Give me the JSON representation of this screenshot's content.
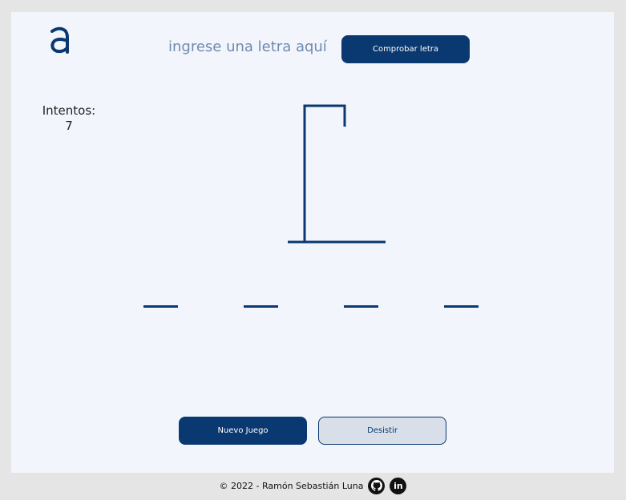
{
  "header": {
    "input_placeholder": "ingrese una letra aquí",
    "check_button_label": "Comprobar letra"
  },
  "game": {
    "tries_label": "Intentos:",
    "tries_value": "7",
    "word_slots": 4
  },
  "actions": {
    "new_game_label": "Nuevo Juego",
    "give_up_label": "Desistir"
  },
  "footer": {
    "copyright": "© 2022 - Ramón Sebastián Luna",
    "linkedin_glyph": "in",
    "icons": [
      "github-icon",
      "linkedin-icon"
    ]
  },
  "colors": {
    "accent": "#0a3871",
    "background": "#f3f5fc",
    "outer": "#e5e5e5"
  }
}
